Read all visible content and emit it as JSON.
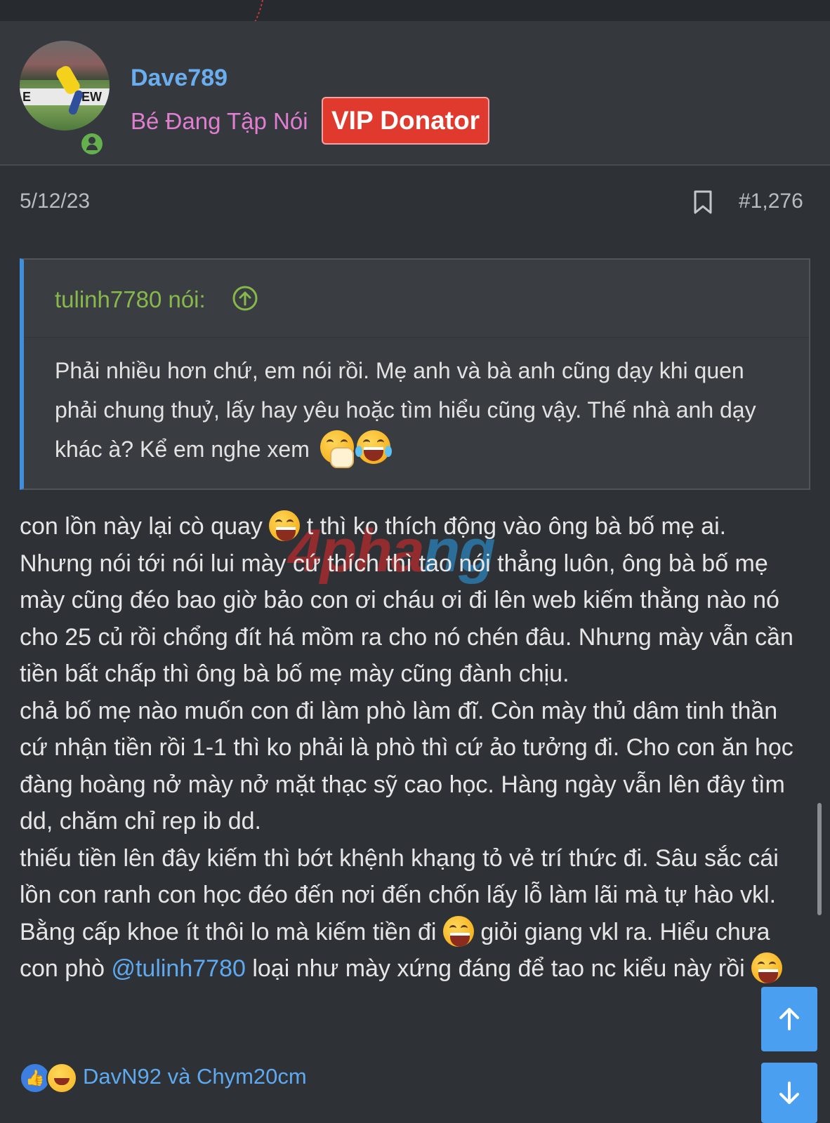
{
  "author": {
    "name": "Dave789",
    "title": "Bé Đang Tập Nói",
    "badge": "VIP Donator",
    "online": true,
    "avatar_board_left": "E",
    "avatar_board_right": "EW"
  },
  "post": {
    "date": "5/12/23",
    "number": "#1,276"
  },
  "quote": {
    "author_label": "tulinh7780 nói:",
    "text": "Phải nhiều hơn chứ, em nói rồi. Mẹ anh và bà anh cũng dạy khi quen phải chung thuỷ, lấy hay yêu hoặc tìm hiểu cũng vậy. Thế nhà anh dạy khác à? Kể em nghe xem"
  },
  "body": {
    "p1a": "con lồn này lại cò quay ",
    "p1b": " t thì ko thích động vào ông bà bố mẹ ai. Nhưng nói tới nói lui mày cứ thích thì tao nói thẳng luôn, ông bà bố mẹ mày cũng đéo bao giờ bảo con ơi cháu ơi đi lên web kiếm thằng nào nó cho 25 củ rồi chổng đít há mồm ra cho nó chén đâu. Nhưng mày vẫn cần tiền bất chấp thì ông bà bố mẹ mày cũng đành chịu.",
    "p2": "chả bố mẹ nào muốn con đi làm phò làm đĩ. Còn mày thủ dâm tinh thần cứ nhận tiền rồi 1-1 thì ko phải là phò thì cứ ảo tưởng đi. Cho con ăn học đàng hoàng nở mày nở mặt thạc sỹ cao học. Hàng ngày vẫn lên đây tìm dd, chăm chỉ rep ib dd.",
    "p3a": "thiếu tiền lên đây kiếm thì bớt khệnh khạng tỏ vẻ trí thức đi. Sâu sắc cái lồn con ranh con học đéo đến nơi đến chốn lấy lỗ làm lãi mà tự hào vkl. Bằng cấp khoe ít thôi lo mà kiếm tiền đi ",
    "p3b": " giỏi giang vkl ra. Hiểu chưa con phò ",
    "mention": "@tulinh7780",
    "p3c": " loại như mày xứng đáng để tao nc kiểu này rồi "
  },
  "watermark": {
    "red": "4pha",
    "blue": "ng"
  },
  "reactions": {
    "names": "DavN92 và Chym20cm",
    "types": [
      "like-icon",
      "haha-icon"
    ]
  },
  "colors": {
    "accent": "#4a9ff0",
    "username": "#6aaef0",
    "user_title": "#e07ed0",
    "vip_badge": "#e03a2e",
    "quote_author": "#87b94a",
    "background": "#2e3236"
  }
}
